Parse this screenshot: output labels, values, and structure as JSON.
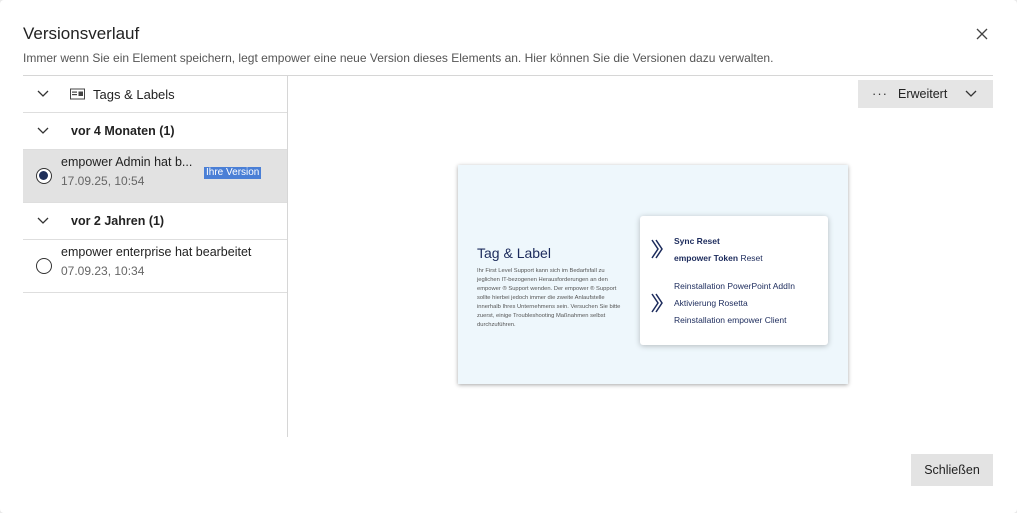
{
  "dialog": {
    "title": "Versionsverlauf",
    "subtitle": "Immer wenn Sie ein Element speichern, legt empower eine neue Version dieses Elements an. Hier können Sie die Versionen dazu verwalten."
  },
  "left_panel": {
    "element_label": "Tags & Labels",
    "groups": [
      {
        "label": "vor 4 Monaten (1)",
        "versions": [
          {
            "title": "empower Admin hat bearbeitet",
            "title_shown": "empower Admin hat b...",
            "date": "17.09.25, 10:54",
            "badge": "Ihre Version",
            "selected": true
          }
        ]
      },
      {
        "label": "vor 2 Jahren (1)",
        "versions": [
          {
            "title": "empower enterprise hat bearbeitet",
            "date": "07.09.23, 10:34",
            "selected": false
          }
        ]
      }
    ]
  },
  "toolbar": {
    "advanced_label": "Erweitert"
  },
  "preview": {
    "heading": "Tag & Label",
    "text": "Ihr First Level Support kann sich im Bedarfsfall zu jeglichen IT-bezogenen Herausforderungen an den empower ® Support wenden. Der empower ® Support sollte hierbei jedoch immer die zweite Anlaufstelle innerhalb Ihres Unternehmens sein. Versuchen Sie bitte zuerst, einige Troubleshooting Maßnahmen selbst durchzuführen.",
    "card": {
      "line1": "Sync Reset",
      "line2_bold": "empower Token",
      "line2_rest": " Reset",
      "line3": "Reinstallation PowerPoint AddIn",
      "line4": "Aktivierung Rosetta",
      "line5": "Reinstallation empower Client"
    }
  },
  "footer": {
    "close_label": "Schließen"
  },
  "colors": {
    "accent_navy": "#1c2b5c",
    "badge_blue": "#4a7fd6",
    "selected_row": "#e2e2e2"
  }
}
